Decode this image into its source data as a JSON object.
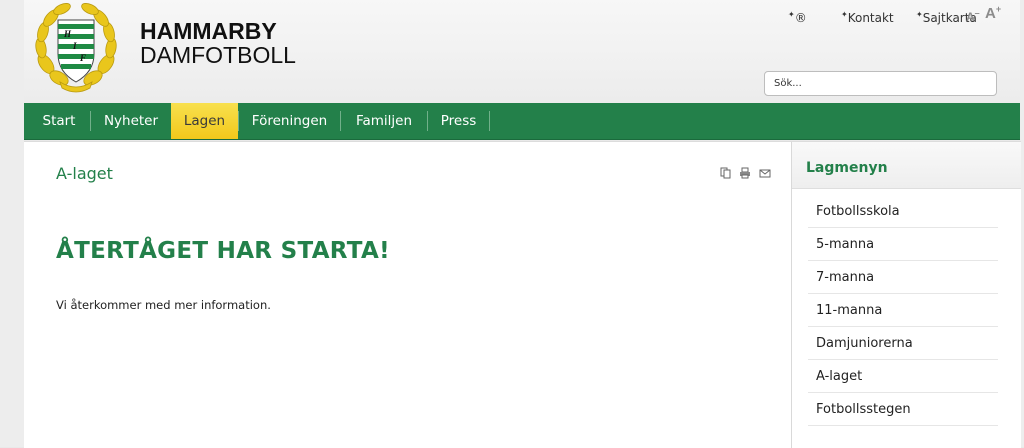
{
  "brand": {
    "line1": "HAMMARBY",
    "line2": "DAMFOTBOLL",
    "logo_letters": "HIF"
  },
  "toplinks": {
    "registered": "®",
    "items": [
      "Kontakt",
      "Sajtkarta"
    ],
    "font_decrease": "A",
    "font_increase": "A",
    "minus": "–",
    "plus": "+"
  },
  "search": {
    "value": "Sök..."
  },
  "nav": {
    "items": [
      "Start",
      "Nyheter",
      "Lagen",
      "Föreningen",
      "Familjen",
      "Press"
    ],
    "active_index": 2
  },
  "content": {
    "page_title": "A-laget",
    "headline": "ÅTERTÅGET HAR STARTA!",
    "body": "Vi återkommer med mer information.",
    "tools": [
      "pdf-icon",
      "print-icon",
      "email-icon"
    ]
  },
  "sidebar": {
    "title": "Lagmenyn",
    "items": [
      "Fotbollsskola",
      "5-manna",
      "7-manna",
      "11-manna",
      "Damjuniorerna",
      "A-laget",
      "Fotbollsstegen"
    ]
  },
  "colors": {
    "brand_green": "#23804a",
    "active_tab": "#f2c81b",
    "logo_yellow": "#f2cf1f"
  }
}
